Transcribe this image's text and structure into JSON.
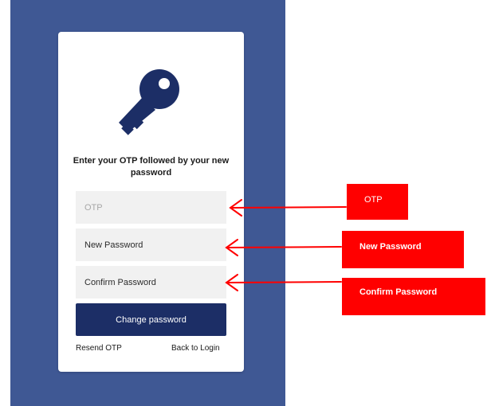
{
  "colors": {
    "background_blue": "#3f5894",
    "card": "#ffffff",
    "button": "#1c2e66",
    "key_icon": "#1c2e66",
    "annotation_red": "#ff0000"
  },
  "icon": "key-icon",
  "form": {
    "heading": "Enter your OTP followed by your new password",
    "otp_placeholder": "OTP",
    "new_password_placeholder": "New Password",
    "confirm_password_placeholder": "Confirm Password",
    "submit_label": "Change password",
    "resend_label": "Resend OTP",
    "back_label": "Back to Login"
  },
  "annotations": {
    "otp": "OTP",
    "new_password": "New Password",
    "confirm_password": "Confirm Password"
  }
}
